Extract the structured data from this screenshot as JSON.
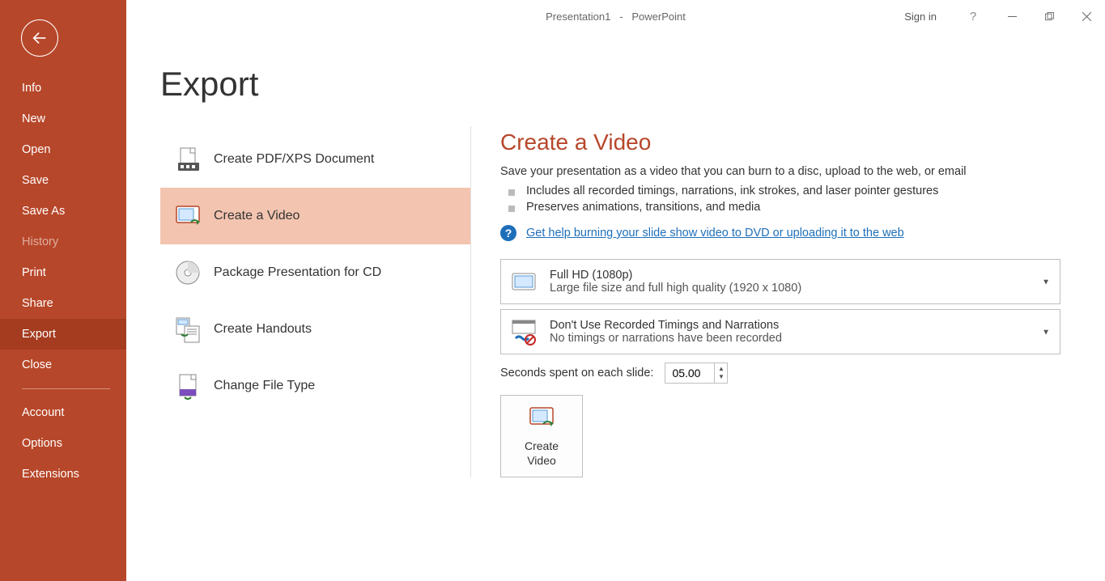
{
  "window": {
    "title_doc": "Presentation1",
    "title_sep": "-",
    "title_app": "PowerPoint",
    "signin": "Sign in"
  },
  "sidebar": {
    "items": [
      {
        "label": "Info"
      },
      {
        "label": "New"
      },
      {
        "label": "Open"
      },
      {
        "label": "Save"
      },
      {
        "label": "Save As"
      },
      {
        "label": "History"
      },
      {
        "label": "Print"
      },
      {
        "label": "Share"
      },
      {
        "label": "Export"
      },
      {
        "label": "Close"
      }
    ],
    "footer": [
      {
        "label": "Account"
      },
      {
        "label": "Options"
      },
      {
        "label": "Extensions"
      }
    ]
  },
  "page": {
    "title": "Export",
    "export_options": [
      {
        "label": "Create PDF/XPS Document"
      },
      {
        "label": "Create a Video"
      },
      {
        "label": "Package Presentation for CD"
      },
      {
        "label": "Create Handouts"
      },
      {
        "label": "Change File Type"
      }
    ]
  },
  "detail": {
    "title": "Create a Video",
    "description": "Save your presentation as a video that you can burn to a disc, upload to the web, or email",
    "bullets": [
      "Includes all recorded timings, narrations, ink strokes, and laser pointer gestures",
      "Preserves animations, transitions, and media"
    ],
    "help_link": "Get help burning your slide show video to DVD or uploading it to the web",
    "quality": {
      "title": "Full HD (1080p)",
      "sub": "Large file size and full high quality (1920 x 1080)"
    },
    "timings": {
      "title": "Don't Use Recorded Timings and Narrations",
      "sub": "No timings or narrations have been recorded"
    },
    "seconds_label": "Seconds spent on each slide:",
    "seconds_value": "05.00",
    "create_button": "Create\nVideo"
  }
}
